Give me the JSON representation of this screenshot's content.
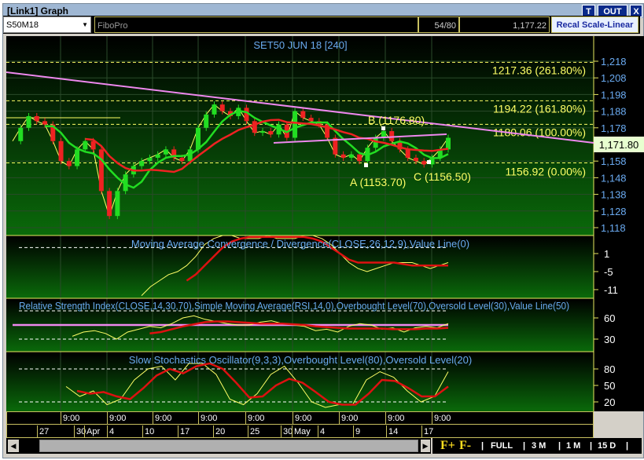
{
  "window": {
    "title": "[Link1] Graph",
    "btn_t": "T",
    "btn_out": "OUT",
    "btn_close": "X"
  },
  "toolbar": {
    "symbol": "S50M18",
    "study": "FiboPro",
    "counter": "54/80",
    "price": "1,177.22",
    "recal": "Recal Scale-Linear"
  },
  "main": {
    "title": "SET50 JUN 18   [240]",
    "last_price": "1,171.80",
    "y_ticks": [
      "1,218",
      "1,208",
      "1,198",
      "1,188",
      "1,178",
      "1,158",
      "1,148",
      "1,138",
      "1,128",
      "1,118"
    ],
    "y_tick_values": [
      1218,
      1208,
      1198,
      1188,
      1178,
      1158,
      1148,
      1138,
      1128,
      1118
    ],
    "fibo": [
      {
        "label": "1217.36 (261.80%)",
        "value": 1217.36
      },
      {
        "label": "1194.22 (161.80%)",
        "value": 1194.22
      },
      {
        "label": "1180.06 (100.00%)",
        "value": 1180.06
      },
      {
        "label": "1156.92 (0.00%)",
        "value": 1156.92
      }
    ],
    "points": {
      "a": "A (1153.70)",
      "b": "B (1176.80)",
      "c": "C (1156.50)"
    },
    "closes": [
      1170,
      1178,
      1185,
      1182,
      1180,
      1170,
      1158,
      1155,
      1165,
      1170,
      1165,
      1140,
      1125,
      1140,
      1150,
      1155,
      1158,
      1160,
      1162,
      1165,
      1160,
      1158,
      1165,
      1178,
      1186,
      1192,
      1188,
      1185,
      1190,
      1182,
      1175,
      1176,
      1174,
      1180,
      1172,
      1188,
      1184,
      1182,
      1180,
      1172,
      1162,
      1160,
      1162,
      1158,
      1166,
      1172,
      1176,
      1170,
      1165,
      1160,
      1158,
      1156,
      1160,
      1165,
      1172
    ],
    "colors": {
      "bull": "#22dd22",
      "bear": "#ee2222",
      "ma_fast": "#22dd22",
      "ma_slow": "#ee2222",
      "trend": "#ee88ee",
      "fibo": "#ffff66"
    }
  },
  "macd": {
    "title": "Moving Average Convergence / Divergence(CLOSE,26,12,9),Value Line(0)",
    "y_ticks": [
      "1",
      "-5",
      "-11"
    ],
    "macd": [
      -13,
      -10,
      -8,
      -6,
      -5,
      -3,
      0,
      4,
      6,
      7,
      7,
      6,
      6,
      6,
      7,
      6,
      6,
      6,
      7,
      7,
      6,
      4,
      1,
      -2,
      -4,
      -5,
      -4,
      -3,
      -2,
      -2,
      -2,
      -3,
      -4,
      -3,
      -2
    ],
    "signal": [
      null,
      null,
      null,
      null,
      null,
      -8,
      -6,
      -3,
      0,
      3,
      5,
      6,
      6.5,
      6.5,
      6.5,
      6.5,
      6.5,
      6.5,
      6.5,
      6,
      5,
      3,
      1,
      -1,
      -2,
      -2,
      -2,
      -2,
      -2,
      -2.5,
      -3,
      -3,
      -3,
      -3,
      -3
    ]
  },
  "rsi": {
    "title": "Relative Strength Index(CLOSE,14,30,70),Simple Moving Average(RSI,14,0),Overbought Level(70),Oversold Level(30),Value Line(50)",
    "y_ticks": [
      "60",
      "30"
    ],
    "rsi": [
      34,
      40,
      42,
      38,
      30,
      40,
      44,
      48,
      46,
      52,
      60,
      63,
      58,
      55,
      52,
      50,
      50,
      54,
      56,
      52,
      50,
      48,
      42,
      44,
      40,
      48,
      52,
      50,
      44,
      46,
      40,
      46,
      48,
      46,
      52
    ],
    "sma": [
      null,
      null,
      null,
      null,
      null,
      null,
      null,
      38,
      40,
      44,
      48,
      51,
      54,
      55,
      55,
      54,
      53,
      52,
      52,
      52,
      51,
      50,
      48,
      47,
      46,
      45,
      45,
      45,
      45,
      44,
      44,
      44,
      45,
      45,
      46
    ]
  },
  "stoch": {
    "title": "Slow Stochastics Oscillator(9,3,3),Overbought Level(80),Oversold Level(20)",
    "y_ticks": [
      "80",
      "50",
      "20"
    ],
    "k": [
      48,
      30,
      40,
      15,
      25,
      60,
      80,
      85,
      60,
      90,
      90,
      70,
      25,
      15,
      35,
      70,
      85,
      55,
      20,
      10,
      15,
      15,
      60,
      75,
      65,
      40,
      20,
      30,
      75
    ],
    "d": [
      40,
      35,
      38,
      30,
      25,
      45,
      68,
      80,
      72,
      85,
      90,
      80,
      55,
      28,
      30,
      50,
      62,
      55,
      38,
      20,
      15,
      15,
      35,
      60,
      58,
      45,
      30,
      30,
      48
    ]
  },
  "time_axis": {
    "hours": [
      "9:00",
      "9:00",
      "9:00",
      "9:00",
      "9:00",
      "9:00",
      "9:00",
      "9:00",
      "9:00"
    ],
    "dates": [
      "27",
      "30",
      "Apr",
      "4",
      "10",
      "17",
      "20",
      "25",
      "30",
      "May",
      "4",
      "9",
      "14",
      "17"
    ]
  },
  "zoom_bar": {
    "f_plus": "F+",
    "f_minus": "F-",
    "full": "FULL",
    "m3": "3 M",
    "m1": "1 M",
    "d15": "15 D"
  }
}
